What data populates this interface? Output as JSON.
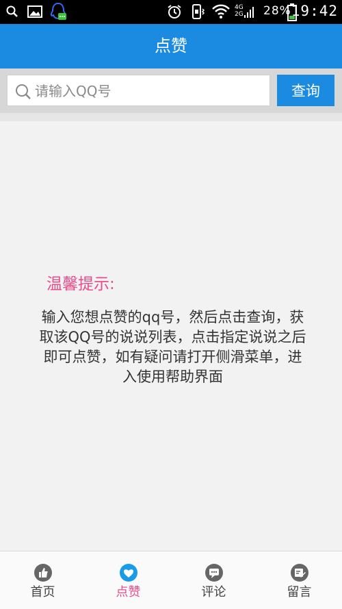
{
  "status_bar": {
    "network_top": "4G",
    "network_bottom": "2G",
    "battery": "28%",
    "time": "19:42"
  },
  "app_bar": {
    "title": "点赞"
  },
  "search": {
    "placeholder": "请输入QQ号",
    "value": "",
    "button_label": "查询"
  },
  "tip": {
    "title": "温馨提示:",
    "body": "输入您想点赞的qq号，然后点击查询，获取该QQ号的说说列表，点击指定说说之后即可点赞，如有疑问请打开侧滑菜单，进入使用帮助界面"
  },
  "nav": {
    "items": [
      {
        "label": "首页",
        "icon": "thumb-icon"
      },
      {
        "label": "点赞",
        "icon": "heart-icon",
        "active": true
      },
      {
        "label": "评论",
        "icon": "comment-icon"
      },
      {
        "label": "留言",
        "icon": "message-icon"
      }
    ]
  },
  "colors": {
    "accent": "#1a8be0",
    "highlight": "#e84c8b"
  }
}
